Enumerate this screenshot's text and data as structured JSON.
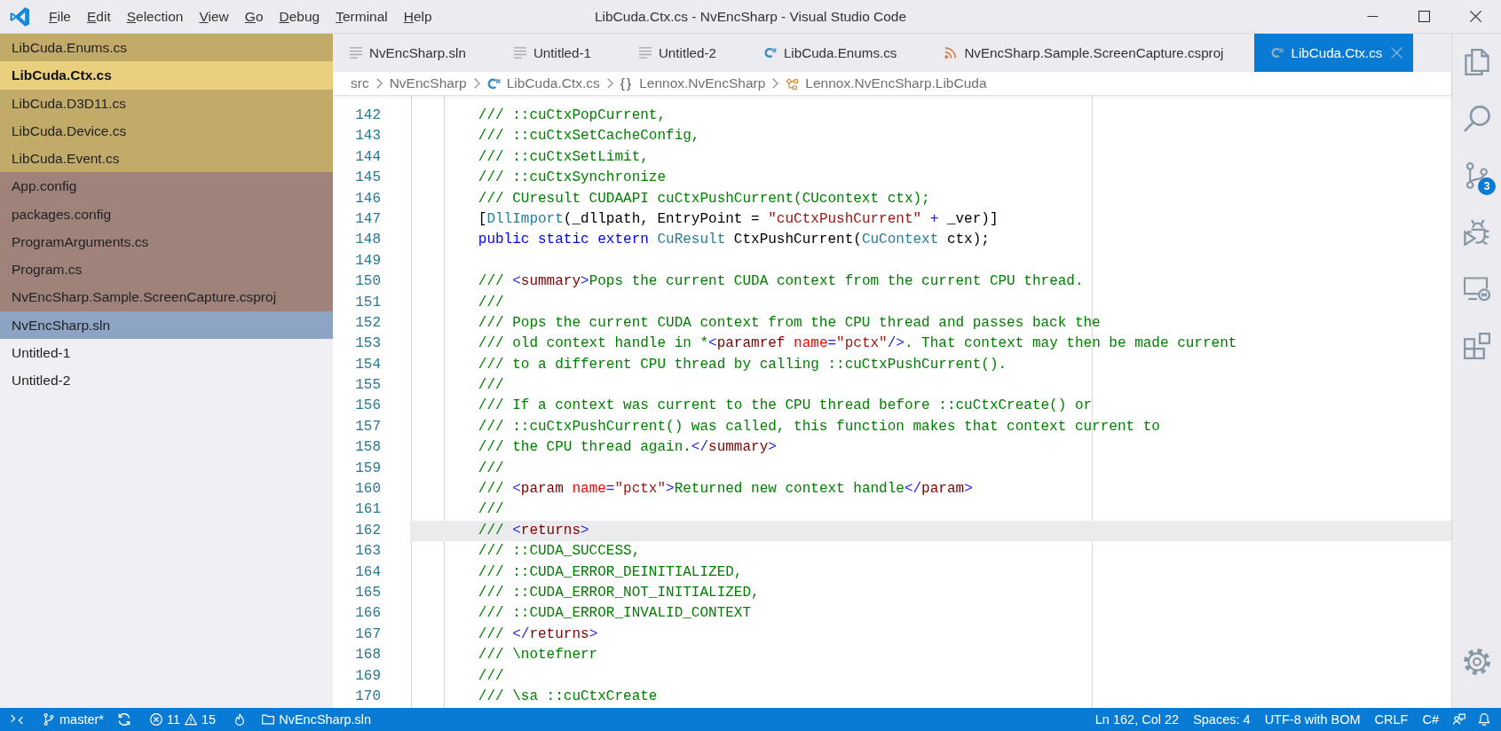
{
  "title_bar": {
    "menu": [
      "File",
      "Edit",
      "Selection",
      "View",
      "Go",
      "Debug",
      "Terminal",
      "Help"
    ],
    "title": "LibCuda.Ctx.cs - NvEncSharp - Visual Studio Code"
  },
  "sidebar": {
    "items": [
      {
        "label": "LibCuda.Enums.cs",
        "color": "#c2ab68",
        "selected": false
      },
      {
        "label": "LibCuda.Ctx.cs",
        "color": "#e9cf7e",
        "selected": true
      },
      {
        "label": "LibCuda.D3D11.cs",
        "color": "#c2ab68",
        "selected": false
      },
      {
        "label": "LibCuda.Device.cs",
        "color": "#c2ab68",
        "selected": false
      },
      {
        "label": "LibCuda.Event.cs",
        "color": "#c2ab68",
        "selected": false
      },
      {
        "label": "App.config",
        "color": "#9f837b",
        "selected": false
      },
      {
        "label": "packages.config",
        "color": "#9f837b",
        "selected": false
      },
      {
        "label": "ProgramArguments.cs",
        "color": "#9f837b",
        "selected": false
      },
      {
        "label": "Program.cs",
        "color": "#9f837b",
        "selected": false
      },
      {
        "label": "NvEncSharp.Sample.ScreenCapture.csproj",
        "color": "#9f837b",
        "selected": false
      },
      {
        "label": "NvEncSharp.sln",
        "color": "#8da4c4",
        "selected": false
      },
      {
        "label": "Untitled-1",
        "selected": false
      },
      {
        "label": "Untitled-2",
        "selected": false
      }
    ]
  },
  "tabs": [
    {
      "label": "NvEncSharp.sln",
      "kind": "text",
      "selected": false
    },
    {
      "label": "Untitled-1",
      "kind": "text",
      "selected": false
    },
    {
      "label": "Untitled-2",
      "kind": "text",
      "selected": false
    },
    {
      "label": "LibCuda.Enums.cs",
      "kind": "csharp",
      "selected": false
    },
    {
      "label": "NvEncSharp.Sample.ScreenCapture.csproj",
      "kind": "project",
      "selected": false
    },
    {
      "label": "LibCuda.Ctx.cs",
      "kind": "csharp",
      "selected": true
    }
  ],
  "breadcrumbs": [
    {
      "label": "src",
      "kind": "folder"
    },
    {
      "label": "NvEncSharp",
      "kind": "folder"
    },
    {
      "label": "LibCuda.Ctx.cs",
      "kind": "csharp"
    },
    {
      "label": "Lennox.NvEncSharp",
      "kind": "namespace",
      "symbol": "{}"
    },
    {
      "label": "Lennox.NvEncSharp.LibCuda",
      "kind": "class"
    }
  ],
  "editor": {
    "lines": [
      {
        "number": "142",
        "current": false,
        "tokens": [
          {
            "kind": "comment",
            "text": "/// ::cuCtxPopCurrent,"
          }
        ]
      },
      {
        "number": "143",
        "current": false,
        "tokens": [
          {
            "kind": "comment",
            "text": "/// ::cuCtxSetCacheConfig,"
          }
        ]
      },
      {
        "number": "144",
        "current": false,
        "tokens": [
          {
            "kind": "comment",
            "text": "/// ::cuCtxSetLimit,"
          }
        ]
      },
      {
        "number": "145",
        "current": false,
        "tokens": [
          {
            "kind": "comment",
            "text": "/// ::cuCtxSynchronize"
          }
        ]
      },
      {
        "number": "146",
        "current": false,
        "tokens": [
          {
            "kind": "comment",
            "text": "/// CUresult CUDAAPI cuCtxPushCurrent(CUcontext ctx);"
          }
        ]
      },
      {
        "number": "147",
        "current": false,
        "tokens": [
          {
            "kind": "plain",
            "text": "["
          },
          {
            "kind": "type",
            "text": "DllImport"
          },
          {
            "kind": "plain",
            "text": "(_dllpath, EntryPoint = "
          },
          {
            "kind": "string",
            "text": "\"cuCtxPushCurrent\""
          },
          {
            "kind": "operator",
            "text": " + "
          },
          {
            "kind": "plain",
            "text": "_ver)]"
          }
        ]
      },
      {
        "number": "148",
        "current": false,
        "tokens": [
          {
            "kind": "keyword",
            "text": "public static extern "
          },
          {
            "kind": "type",
            "text": "CuResult"
          },
          {
            "kind": "plain",
            "text": " CtxPushCurrent("
          },
          {
            "kind": "type",
            "text": "CuContext"
          },
          {
            "kind": "plain",
            "text": " ctx);"
          }
        ]
      },
      {
        "number": "149",
        "current": false
      },
      {
        "number": "150",
        "current": false,
        "tokens": [
          {
            "kind": "comment",
            "text": "/// "
          },
          {
            "kind": "punct",
            "text": "<"
          },
          {
            "kind": "tag",
            "text": "summary"
          },
          {
            "kind": "punct",
            "text": ">"
          },
          {
            "kind": "comment",
            "text": "Pops the current CUDA context from the current CPU thread."
          }
        ]
      },
      {
        "number": "151",
        "current": false,
        "tokens": [
          {
            "kind": "comment",
            "text": "///"
          }
        ]
      },
      {
        "number": "152",
        "current": false,
        "tokens": [
          {
            "kind": "comment",
            "text": "/// Pops the current CUDA context from the CPU thread and passes back the"
          }
        ]
      },
      {
        "number": "153",
        "current": false,
        "tokens": [
          {
            "kind": "comment",
            "text": "/// old context handle in *"
          },
          {
            "kind": "punct",
            "text": "<"
          },
          {
            "kind": "tag",
            "text": "paramref "
          },
          {
            "kind": "attr",
            "text": "name"
          },
          {
            "kind": "punct",
            "text": "="
          },
          {
            "kind": "value",
            "text": "\"pctx\""
          },
          {
            "kind": "punct",
            "text": "/>"
          },
          {
            "kind": "comment",
            "text": ". That context may then be made current"
          }
        ]
      },
      {
        "number": "154",
        "current": false,
        "tokens": [
          {
            "kind": "comment",
            "text": "/// to a different CPU thread by calling ::cuCtxPushCurrent()."
          }
        ]
      },
      {
        "number": "155",
        "current": false,
        "tokens": [
          {
            "kind": "comment",
            "text": "///"
          }
        ]
      },
      {
        "number": "156",
        "current": false,
        "tokens": [
          {
            "kind": "comment",
            "text": "/// If a context was current to the CPU thread before ::cuCtxCreate() or"
          }
        ]
      },
      {
        "number": "157",
        "current": false,
        "tokens": [
          {
            "kind": "comment",
            "text": "/// ::cuCtxPushCurrent() was called, this function makes that context current to"
          }
        ]
      },
      {
        "number": "158",
        "current": false,
        "tokens": [
          {
            "kind": "comment",
            "text": "/// the CPU thread again."
          },
          {
            "kind": "punct",
            "text": "</"
          },
          {
            "kind": "tag",
            "text": "summary"
          },
          {
            "kind": "punct",
            "text": ">"
          }
        ]
      },
      {
        "number": "159",
        "current": false,
        "tokens": [
          {
            "kind": "comment",
            "text": "///"
          }
        ]
      },
      {
        "number": "160",
        "current": false,
        "tokens": [
          {
            "kind": "comment",
            "text": "/// "
          },
          {
            "kind": "punct",
            "text": "<"
          },
          {
            "kind": "tag",
            "text": "param "
          },
          {
            "kind": "attr",
            "text": "name"
          },
          {
            "kind": "punct",
            "text": "="
          },
          {
            "kind": "value",
            "text": "\"pctx\""
          },
          {
            "kind": "punct",
            "text": ">"
          },
          {
            "kind": "comment",
            "text": "Returned new context handle"
          },
          {
            "kind": "punct",
            "text": "</"
          },
          {
            "kind": "tag",
            "text": "param"
          },
          {
            "kind": "punct",
            "text": ">"
          }
        ]
      },
      {
        "number": "161",
        "current": false,
        "tokens": [
          {
            "kind": "comment",
            "text": "///"
          }
        ]
      },
      {
        "number": "162",
        "current": true,
        "tokens": [
          {
            "kind": "comment",
            "text": "/// "
          },
          {
            "kind": "punct",
            "text": "<"
          },
          {
            "kind": "tag",
            "text": "returns"
          },
          {
            "kind": "punct",
            "text": ">"
          }
        ]
      },
      {
        "number": "163",
        "current": false,
        "tokens": [
          {
            "kind": "comment",
            "text": "/// ::CUDA_SUCCESS,"
          }
        ]
      },
      {
        "number": "164",
        "current": false,
        "tokens": [
          {
            "kind": "comment",
            "text": "/// ::CUDA_ERROR_DEINITIALIZED,"
          }
        ]
      },
      {
        "number": "165",
        "current": false,
        "tokens": [
          {
            "kind": "comment",
            "text": "/// ::CUDA_ERROR_NOT_INITIALIZED,"
          }
        ]
      },
      {
        "number": "166",
        "current": false,
        "tokens": [
          {
            "kind": "comment",
            "text": "/// ::CUDA_ERROR_INVALID_CONTEXT"
          }
        ]
      },
      {
        "number": "167",
        "current": false,
        "tokens": [
          {
            "kind": "comment",
            "text": "/// "
          },
          {
            "kind": "punct",
            "text": "</"
          },
          {
            "kind": "tag",
            "text": "returns"
          },
          {
            "kind": "punct",
            "text": ">"
          }
        ]
      },
      {
        "number": "168",
        "current": false,
        "tokens": [
          {
            "kind": "comment",
            "text": "/// \\notefnerr"
          }
        ]
      },
      {
        "number": "169",
        "current": false,
        "tokens": [
          {
            "kind": "comment",
            "text": "///"
          }
        ]
      },
      {
        "number": "170",
        "current": false,
        "tokens": [
          {
            "kind": "comment",
            "text": "/// \\sa ::cuCtxCreate"
          }
        ]
      }
    ]
  },
  "activity_bar": {
    "source_control_badge": "3"
  },
  "status_bar": {
    "branch": "master*",
    "errors": "11",
    "warnings": "15",
    "solution": "NvEncSharp.sln",
    "position": "Ln 162, Col 22",
    "indentation": "Spaces: 4",
    "encoding": "UTF-8 with BOM",
    "line_ending": "CRLF",
    "language": "C#"
  }
}
